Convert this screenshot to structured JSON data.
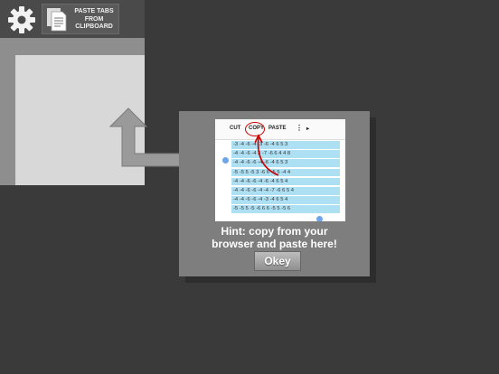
{
  "topbar": {
    "settings_icon": "gear-icon",
    "paste_button": {
      "icon": "document-icon",
      "label_lines": [
        "PASTE TABS",
        "FROM",
        "CLIPBOARD"
      ]
    }
  },
  "dialog": {
    "preview": {
      "toolbar": {
        "cut": "CUT",
        "copy": "COPY",
        "paste": "PASTE",
        "more": "⋮",
        "next": "▸"
      },
      "rows": [
        "-3 -4 -6 -4     -3 -6 -4 6 5 3",
        "-4 -4 -6 -4 3 -7 -6 6 4 4 8",
        "-4 -4 -6 -6     -4 -6 -4 6 5 3",
        "-5 -5 5 -5 3 -6 6 -5 5 -4 4",
        "-4 -4 -6 -6     -4 -6 -4 6 5 4",
        "-4 -4 -6 -6 -4 -4 -7 -6 6 5 4",
        "-4 -4 -6 -6     -4 -3 -4 6 5 4",
        "-5 -5 5 -5 -6 6 6 -5 5 -5 6"
      ]
    },
    "hint_lines": [
      "Hint:  copy from your",
      "browser and paste here!"
    ],
    "ok_label": "Okey"
  },
  "colors": {
    "background": "#3a3a3a",
    "dialog": "#7e7e7e",
    "row_highlight": "#aee0f4",
    "annotation_red": "#cc0000",
    "selection_handle": "#6da6e8"
  }
}
